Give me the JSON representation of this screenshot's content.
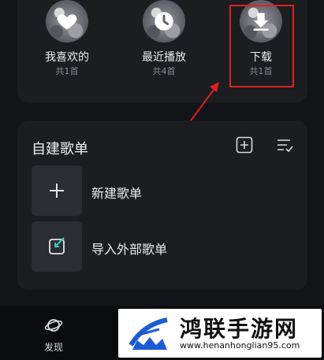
{
  "top_tiles": [
    {
      "title": "我喜欢的",
      "count": "共1首",
      "icon": "heart-icon"
    },
    {
      "title": "最近播放",
      "count": "共4首",
      "icon": "clock-icon"
    },
    {
      "title": "下载",
      "count": "共1首",
      "icon": "download-icon"
    }
  ],
  "section": {
    "title": "自建歌单",
    "actions": [
      "add-icon",
      "sort-icon"
    ]
  },
  "rows": [
    {
      "label": "新建歌单",
      "icon": "plus-icon"
    },
    {
      "label": "导入外部歌单",
      "icon": "import-icon"
    }
  ],
  "bottom_nav": {
    "discover_label": "发现",
    "discover_icon": "planet-icon"
  },
  "watermark": {
    "title": "鸿联手游网",
    "url": "www.henanhonglian95.com"
  },
  "annotation": {
    "highlight_color": "#e0201f"
  }
}
